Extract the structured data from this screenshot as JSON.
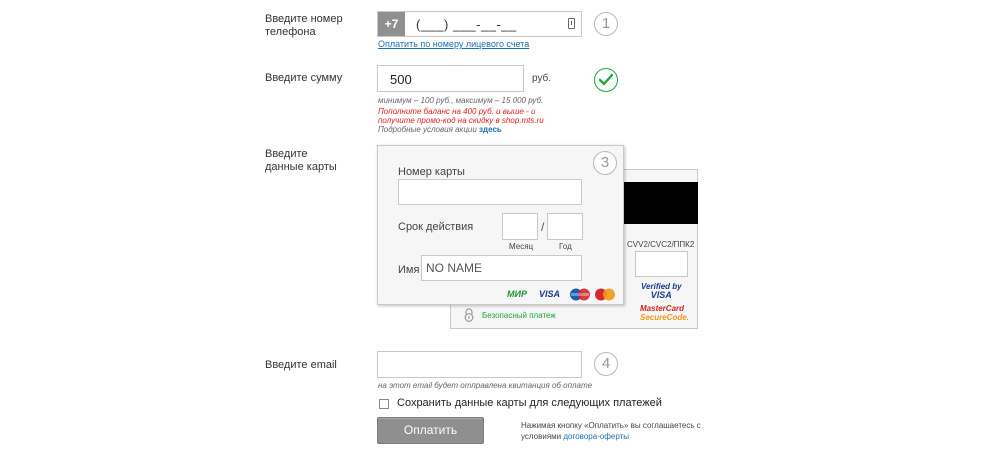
{
  "phone": {
    "label": "Введите номер телефона",
    "prefix": "+7",
    "mask": "(___) ___-__-__",
    "step": "1",
    "link": "Оплатить по номеру лицевого счета"
  },
  "amount": {
    "label": "Введите сумму",
    "value": "500",
    "currency": "руб.",
    "limits": "минимум – 100 руб., максимум – 15 000 руб.",
    "promo_line1": "Пополните баланс на 400 руб. и выше - и",
    "promo_line2": "получите промо-код на скидку в shop.mts.ru",
    "conditions": "Подробные условия акции",
    "conditions_link": "здесь",
    "promo_color": "#e2231a"
  },
  "card": {
    "label_line1": "Введите",
    "label_line2": "данные карты",
    "step": "3",
    "number_label": "Номер карты",
    "expiry_label": "Срок действия",
    "separator": "/",
    "month_label": "Месяц",
    "year_label": "Год",
    "name_label": "Имя",
    "name_placeholder": "NO NAME",
    "cvv_label": "CVV2/CVC2/ППК2",
    "secure_text": "Безопасный платеж",
    "logos": {
      "mir": "МИР",
      "visa": "VISA",
      "maestro": "Maestro",
      "mastercard": "MasterCard"
    },
    "verified_line1": "Verified by",
    "verified_line2": "VISA",
    "securecode_line1": "MasterCard",
    "securecode_line2": "SecureCode."
  },
  "email": {
    "label": "Введите email",
    "step": "4",
    "hint": "на этот email будет отправлена квитанция об оплате"
  },
  "save_card": {
    "label": "Сохранить данные карты для следующих платежей",
    "checked": false
  },
  "submit": {
    "label": "Оплатить",
    "terms_line1": "Нажимая кнопку «Оплатить» вы соглашаетесь с",
    "terms_line2": "условиями",
    "terms_link": "договора-оферты"
  },
  "colors": {
    "accent_green": "#1aa83a",
    "link_blue": "#1a6fb5",
    "button_gray": "#8f8f8f"
  }
}
